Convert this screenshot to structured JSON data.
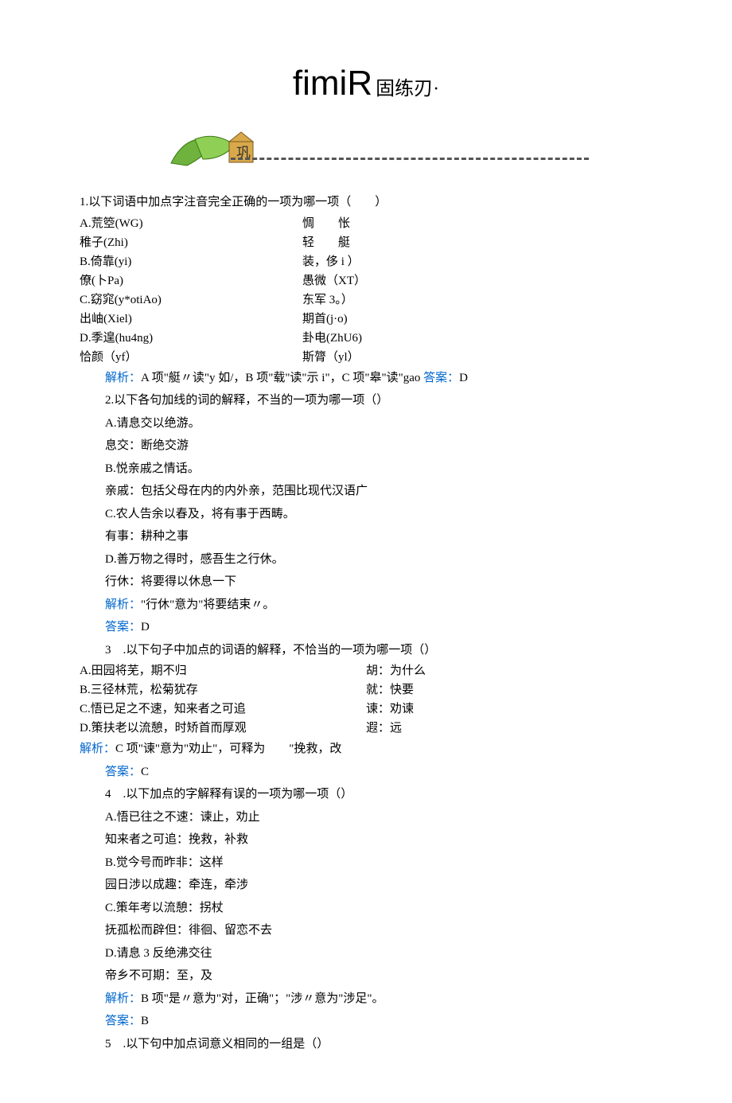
{
  "title": {
    "main": "fimiR",
    "sub": "固练刃·"
  },
  "q1": {
    "stem": "1.以下词语中加点字注音完全正确的一项为哪一项（　　）",
    "rows": [
      [
        "A.荒箜(WG)",
        "惆　　怅"
      ],
      [
        "稚子(Zhi)",
        "轻　　艇"
      ],
      [
        "B.倚靠(yi)",
        "装，侈 i ）"
      ],
      [
        "僚(卜Pa)",
        "愚微（XT）"
      ],
      [
        "C.窈窕(y*otiAo)",
        "东军 3。）"
      ],
      [
        "出岫(Xiel)",
        "期首(j·o)"
      ],
      [
        "D.季遑(hu4ng)",
        "卦电(ZhU6)"
      ],
      [
        "恰颜（yf）",
        "斯膂（yl）"
      ]
    ],
    "analysis_label": "解析：",
    "analysis": "A 项\"艇〃读\"y 如/，B 项\"载\"读\"示 i\"，C 项\"皋\"读\"gao",
    "answer_label": "答案：",
    "answer": "D"
  },
  "q2": {
    "stem": "2.以下各句加线的词的解释，不当的一项为哪一项（）",
    "a1": "A.请息交以绝游。",
    "a2": "息交：断绝交游",
    "b1": "B.悦亲戚之情话。",
    "b2": "亲戚：包括父母在内的内外亲，范围比现代汉语广",
    "c1": "C.农人告余以春及，将有事于西畴。",
    "c2": "有事：耕种之事",
    "d1": "D.善万物之得时，感吾生之行休。",
    "d2": "行休：将要得以休息一下",
    "analysis_label": "解析：",
    "analysis": "\"行休\"意为\"将要结束〃。",
    "answer_label": "答案：",
    "answer": "D"
  },
  "q3": {
    "stem": "3　.以下句子中加点的词语的解释，不恰当的一项为哪一项（）",
    "rows": [
      [
        "A.田园将芜，期不归",
        "胡：为什么"
      ],
      [
        "B.三径林荒，松菊犹存",
        "就：快要"
      ],
      [
        "C.悟已足之不速，知来者之可追",
        "谏：劝谏"
      ],
      [
        "D.策扶老以流憩，时矫首而厚观",
        "遐：远"
      ]
    ],
    "analysis_label": "解析：",
    "analysis": "C 项\"谏\"意为\"劝止\"，可释为　　\"挽救，改",
    "answer_label": "答案：",
    "answer": "C"
  },
  "q4": {
    "stem": "4　.以下加点的字解释有误的一项为哪一项（）",
    "a1": "A.悟已往之不速：谏止，劝止",
    "a2": "知来者之可追：挽救，补救",
    "b1": "B.觉今号而昨非：这样",
    "b2": "园日涉以成趣：牵连，牵涉",
    "c1": "C.策年考以流憩：拐杖",
    "c2": "抚孤松而辟但：徘徊、留恋不去",
    "d1": "D.请息 3 反绝沸交往",
    "d2": "帝乡不可期：至，及",
    "analysis_label": "解析：",
    "analysis": "B 项\"是〃意为\"对，正确\"；\"涉〃意为\"涉足\"。",
    "answer_label": "答案：",
    "answer": "B"
  },
  "q5": {
    "stem": "5　.以下句中加点词意义相同的一组是（）"
  }
}
